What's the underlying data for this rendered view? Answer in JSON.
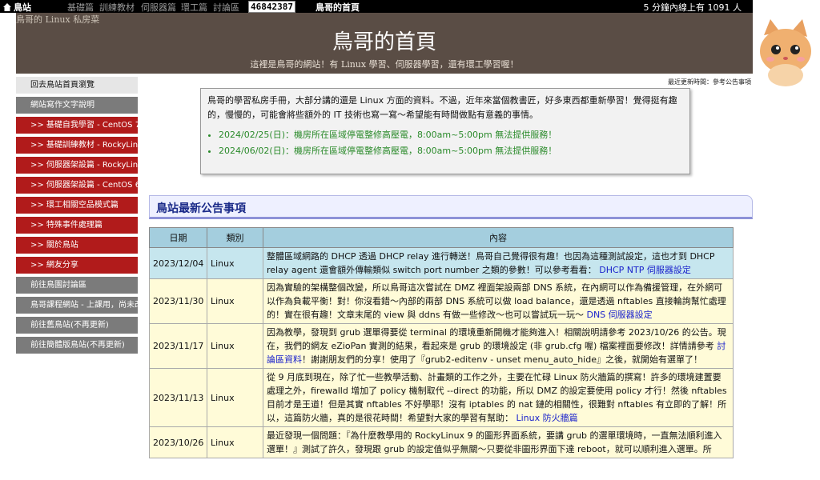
{
  "topbar": {
    "home": "鳥站",
    "nav": [
      "基礎篇",
      "訓練教材",
      "伺服器篇",
      "環工篇",
      "討論區"
    ],
    "counter": "46842387",
    "page_name": "鳥哥的首頁",
    "online": "5 分鐘內線上有 1091 人"
  },
  "header": {
    "site_name": "鳥哥的 Linux 私房菜",
    "title": "鳥哥的首頁",
    "subtitle": "這裡是鳥哥的網站！有 Linux 學習、伺服器學習，還有環工學習喔！",
    "mascot": "cat-mascot-icon"
  },
  "sidebar": {
    "items": [
      {
        "label": "回去鳥站首頁瀏覽",
        "style": "light"
      },
      {
        "label": "網站寫作文字說明",
        "style": "gray"
      },
      {
        "label": ">> 基礎自我學習 - CentOS 7",
        "style": "red"
      },
      {
        "label": ">> 基礎訓練教材 - RockyLinux",
        "style": "red"
      },
      {
        "label": ">> 伺服器架設篇 - RockyLinux",
        "style": "red"
      },
      {
        "label": ">> 伺服器架設篇 - CentOS 6",
        "style": "red"
      },
      {
        "label": ">> 環工相關空品模式篇",
        "style": "red"
      },
      {
        "label": ">> 特殊事件處理篇",
        "style": "red"
      },
      {
        "label": ">> 關於鳥站",
        "style": "red"
      },
      {
        "label": ">> 網友分享",
        "style": "red"
      },
      {
        "label": "前往鳥園討論區",
        "style": "gray"
      },
      {
        "label": "鳥哥課程網站 - 上課用，尚未改",
        "style": "gray"
      },
      {
        "label": "前往舊鳥站(不再更新)",
        "style": "gray"
      },
      {
        "label": "前往簡體版鳥站(不再更新)",
        "style": "gray"
      }
    ]
  },
  "updated": "最近更新時間：參考公告事項",
  "notice": {
    "text": "鳥哥的學習私房手冊，大部分講的還是 Linux 方面的資料。不過，近年來當個教書匠，好多東西都重新學習！覺得挺有趣的，慢慢的，可能會將些額外的 IT 技術也寫一寫～希望能有時間做點有意義的事情。",
    "items": [
      "2024/02/25(日)：機房所在區域停電整修高壓電，8:00am~5:00pm 無法提供服務！",
      "2024/06/02(日)：機房所在區域停電整修高壓電，8:00am~5:00pm 無法提供服務！"
    ]
  },
  "section_title": "鳥站最新公告事項",
  "table": {
    "headers": [
      "日期",
      "類別",
      "內容"
    ],
    "rows": [
      {
        "date": "2023/12/04",
        "kind": "Linux",
        "text": "整體區域網路的 DHCP 透過 DHCP relay 進行轉送！鳥哥自己覺得很有趣！也因為這種測試設定，這也才到 DHCP relay agent 還會額外傳輸類似 switch port number 之類的參數！可以參考看看：",
        "link": "DHCP NTP 伺服器設定",
        "after": ""
      },
      {
        "date": "2023/11/30",
        "kind": "Linux",
        "text": "因為實驗的架構整個改變，所以鳥哥這次嘗試在 DMZ 裡面架設兩部 DNS 系統，在內網可以作為備援管理，在外網可以作為負載平衡！對！你沒看錯～內部的兩部 DNS 系統可以做 load balance，還是透過 nftables 直接輪詢幫忙處理的！實在很有趣！文章末尾的 view 與 ddns 有做一些修改～也可以嘗試玩一玩～",
        "link": "DNS 伺服器設定",
        "after": ""
      },
      {
        "date": "2023/11/17",
        "kind": "Linux",
        "text": "因為教學，發現到 grub 選單得要從 terminal 的環境重新開機才能夠進入！相關說明請參考 2023/10/26 的公告。現在，我們的網友 eZioPan 實測的結果，看起來是 grub 的環境設定 (非 grub.cfg 喔) 檔案裡面要修改！詳情請參考",
        "link": "討論區資料",
        "after": "！謝謝朋友們的分享！使用了『grub2-editenv - unset menu_auto_hide』之後，就開始有選單了！"
      },
      {
        "date": "2023/11/13",
        "kind": "Linux",
        "text": "從 9 月底到現在，除了忙一些教學活動、計畫類的工作之外，主要在忙碌 Linux 防火牆篇的撰寫！許多的環境建置要處理之外，firewalld 增加了 policy 機制取代 --direct 的功能，所以 DMZ 的設定要使用 policy 才行！然後 nftables 目前才是王道！但是其實 nftables 不好學耶！沒有 iptables 的 nat 鏈的相關性，很難對 nftables 有立即的了解！所以，這篇防火牆，真的是很花時間！希望對大家的學習有幫助：",
        "link": "Linux 防火牆篇",
        "after": ""
      },
      {
        "date": "2023/10/26",
        "kind": "Linux",
        "text": "最近發現一個問題：『為什麼教學用的 RockyLinux 9 的圖形界面系統，要講 grub 的選單環境時，一直無法順利進入選單！』測試了許久，發現跟 grub 的設定值似乎無關～只要從非圖形界面下達 reboot，就可以順利進入選單。所",
        "link": "",
        "after": ""
      }
    ]
  }
}
